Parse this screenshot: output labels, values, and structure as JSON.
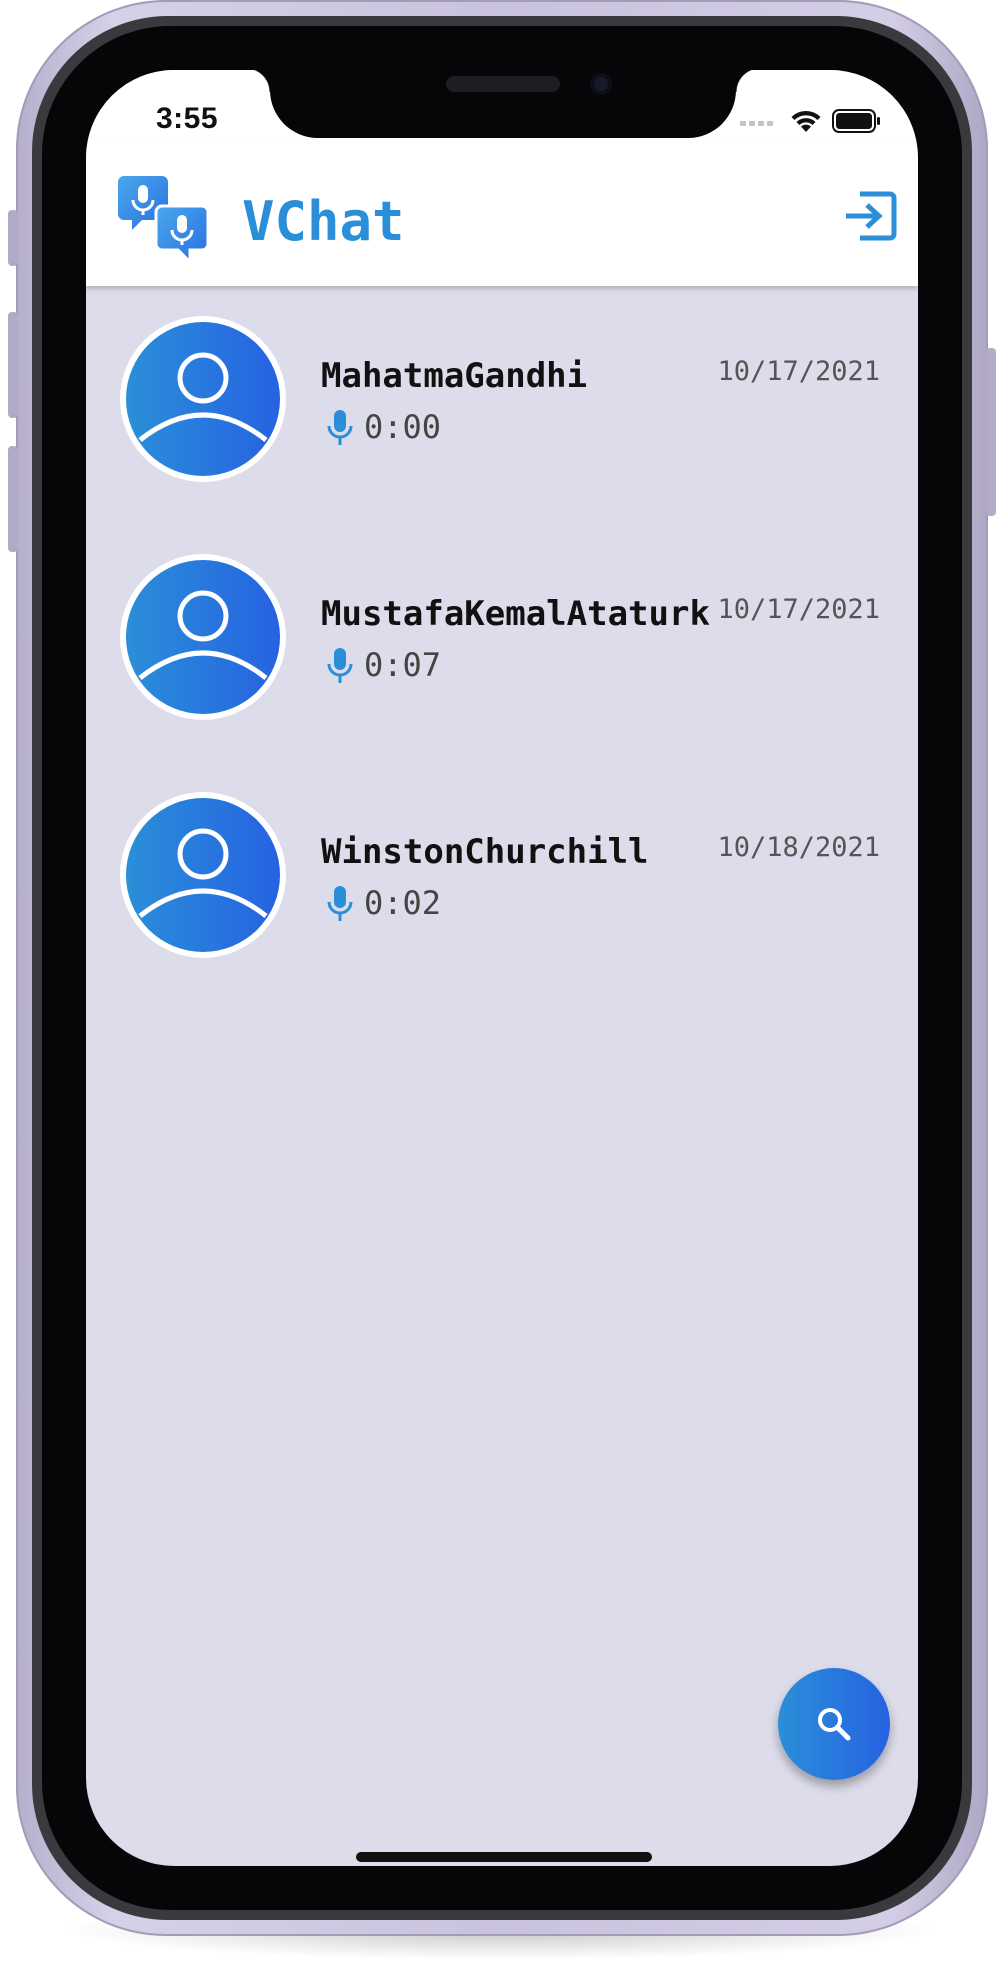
{
  "status_bar": {
    "time": "3:55",
    "icons": [
      "signal-icon",
      "wifi-icon",
      "battery-icon"
    ]
  },
  "app_bar": {
    "title": "VChat",
    "logo_icon": "chat-mic-logo-icon",
    "action_icon": "logout-icon",
    "accent_color": "#2a8fd8"
  },
  "conversations": [
    {
      "name": "MahatmaGandhi",
      "date": "10/17/2021",
      "duration": "0:00"
    },
    {
      "name": "MustafaKemalAtaturk",
      "date": "10/17/2021",
      "duration": "0:07"
    },
    {
      "name": "WinstonChurchill",
      "date": "10/18/2021",
      "duration": "0:02"
    }
  ],
  "fab": {
    "icon": "search-icon"
  },
  "colors": {
    "background": "#dcdcea",
    "gradient_start": "#2a8fd8",
    "gradient_end": "#2662e2",
    "frame": "#c9c2dc"
  }
}
